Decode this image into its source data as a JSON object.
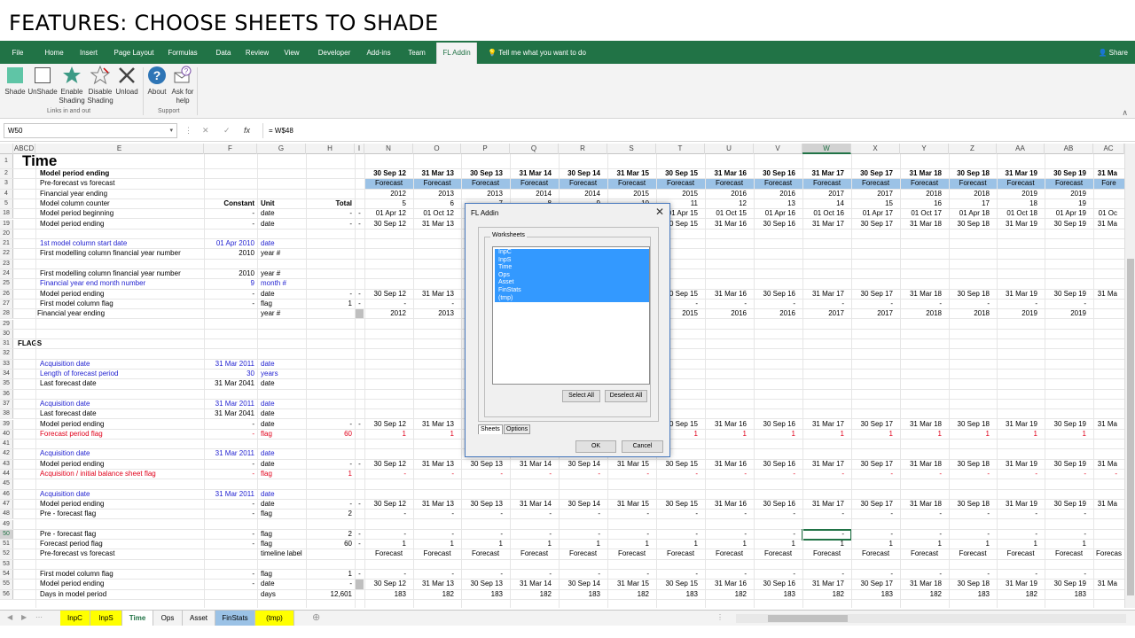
{
  "slide_title": "FEATURES: CHOOSE SHEETS TO SHADE",
  "ribbon_tabs": [
    "File",
    "Home",
    "Insert",
    "Page Layout",
    "Formulas",
    "Data",
    "Review",
    "View",
    "Developer",
    "Add-ins",
    "Team",
    "FL Addin"
  ],
  "active_ribbon_tab": "FL Addin",
  "tell_me": "Tell me what you want to do",
  "share": "Share",
  "ribbon_buttons": [
    {
      "label1": "Shade",
      "label2": "",
      "icon": "shade-square-icon"
    },
    {
      "label1": "UnShade",
      "label2": "",
      "icon": "empty-square-icon"
    },
    {
      "label1": "Enable",
      "label2": "Shading",
      "icon": "star-icon"
    },
    {
      "label1": "Disable",
      "label2": "Shading",
      "icon": "star-outline-icon"
    },
    {
      "label1": "Unload",
      "label2": "",
      "icon": "close-x-icon"
    },
    {
      "label1": "About",
      "label2": "",
      "icon": "help-icon"
    },
    {
      "label1": "Ask for",
      "label2": "help",
      "icon": "email-help-icon"
    }
  ],
  "ribbon_groups": [
    "Links in and out",
    "Support"
  ],
  "name_box": "W50",
  "formula_text": "= W$48",
  "fx_label": "fx",
  "col_headers": [
    "ABCD",
    "E",
    "F",
    "G",
    "H",
    "I",
    "N",
    "O",
    "P",
    "Q",
    "R",
    "S",
    "T",
    "U",
    "V",
    "W",
    "X",
    "Y",
    "Z",
    "AA",
    "AB",
    "AC"
  ],
  "timeline_columns": [
    "N",
    "O",
    "P",
    "Q",
    "R",
    "S",
    "T",
    "U",
    "V",
    "W",
    "X",
    "Y",
    "Z",
    "AA",
    "AB",
    "AC"
  ],
  "rows": [
    {
      "n": "1",
      "title": "Time"
    },
    {
      "n": "2",
      "e": "Model period ending",
      "bold": true,
      "t": [
        "30 Sep 12",
        "31 Mar 13",
        "30 Sep 13",
        "31 Mar 14",
        "30 Sep 14",
        "31 Mar 15",
        "30 Sep 15",
        "31 Mar 16",
        "30 Sep 16",
        "31 Mar 17",
        "30 Sep 17",
        "31 Mar 18",
        "30 Sep 18",
        "31 Mar 19",
        "30 Sep 19",
        "31 Ma"
      ]
    },
    {
      "n": "3",
      "e": "Pre-forecast vs forecast",
      "fc": true,
      "t": [
        "Forecast",
        "Forecast",
        "Forecast",
        "Forecast",
        "Forecast",
        "Forecast",
        "Forecast",
        "Forecast",
        "Forecast",
        "Forecast",
        "Forecast",
        "Forecast",
        "Forecast",
        "Forecast",
        "Forecast",
        "Fore"
      ]
    },
    {
      "n": "4",
      "e": "Financial year ending",
      "t": [
        "2012",
        "2013",
        "2013",
        "2014",
        "2014",
        "2015",
        "2015",
        "2016",
        "2016",
        "2017",
        "2017",
        "2018",
        "2018",
        "2019",
        "2019",
        ""
      ]
    },
    {
      "n": "5",
      "e": "Model column counter",
      "f": "Constant",
      "g": "Unit",
      "h": "Total",
      "t": [
        "5",
        "6",
        "7",
        "8",
        "9",
        "10",
        "11",
        "12",
        "13",
        "14",
        "15",
        "16",
        "17",
        "18",
        "19",
        ""
      ]
    },
    {
      "n": "18",
      "e": "Model period beginning",
      "f": "-",
      "g": "date",
      "h": "-",
      "i": "-",
      "t": [
        "01 Apr 12",
        "01 Oct 12",
        "01 Apr 13",
        "01 Oct 13",
        "01 Apr 14",
        "01 Oct 14",
        "01 Apr 15",
        "01 Oct 15",
        "01 Apr 16",
        "01 Oct 16",
        "01 Apr 17",
        "01 Oct 17",
        "01 Apr 18",
        "01 Oct 18",
        "01 Apr 19",
        "01 Oc"
      ]
    },
    {
      "n": "19",
      "e": "Model period ending",
      "f": "-",
      "g": "date",
      "h": "-",
      "i": "-",
      "t": [
        "30 Sep 12",
        "31 Mar 13",
        "30 Sep 13",
        "31 Mar 14",
        "30 Sep 14",
        "31 Mar 15",
        "30 Sep 15",
        "31 Mar 16",
        "30 Sep 16",
        "31 Mar 17",
        "30 Sep 17",
        "31 Mar 18",
        "30 Sep 18",
        "31 Mar 19",
        "30 Sep 19",
        "31 Ma"
      ]
    },
    {
      "n": "20"
    },
    {
      "n": "21",
      "e": "1st model column start date",
      "f": "01 Apr 2010",
      "g": "date",
      "blue": true
    },
    {
      "n": "22",
      "e": "First modelling column financial year number",
      "f": "2010",
      "g": "year #"
    },
    {
      "n": "23"
    },
    {
      "n": "24",
      "e": "First modelling column financial year number",
      "f": "2010",
      "g": "year #"
    },
    {
      "n": "25",
      "e": "Financial year end month number",
      "f": "9",
      "g": "month #",
      "blue": true
    },
    {
      "n": "26",
      "e": "Model period ending",
      "f": "-",
      "g": "date",
      "h": "-",
      "i": "-",
      "t": [
        "30 Sep 12",
        "31 Mar 13",
        "30 Sep 13",
        "31 Mar 14",
        "30 Sep 14",
        "31 Mar 15",
        "30 Sep 15",
        "31 Mar 16",
        "30 Sep 16",
        "31 Mar 17",
        "30 Sep 17",
        "31 Mar 18",
        "30 Sep 18",
        "31 Mar 19",
        "30 Sep 19",
        "31 Ma"
      ]
    },
    {
      "n": "27",
      "e": "First model column flag",
      "f": "-",
      "g": "flag",
      "h": "1",
      "i": "-",
      "t": [
        "-",
        "-",
        "-",
        "-",
        "-",
        "-",
        "-",
        "-",
        "-",
        "-",
        "-",
        "-",
        "-",
        "-",
        "-",
        ""
      ]
    },
    {
      "n": "28",
      "e": "Financial year ending",
      "g": "year #",
      "grey_i": true,
      "t": [
        "2012",
        "2013",
        "2013",
        "2014",
        "2014",
        "2015",
        "2015",
        "2016",
        "2016",
        "2017",
        "2017",
        "2018",
        "2018",
        "2019",
        "2019",
        ""
      ],
      "indent": true
    },
    {
      "n": "29"
    },
    {
      "n": "30"
    },
    {
      "n": "31",
      "d": "FLAGS",
      "bold": true
    },
    {
      "n": "32"
    },
    {
      "n": "33",
      "e": "Acquisition date",
      "f": "31 Mar 2011",
      "g": "date",
      "blue": true
    },
    {
      "n": "34",
      "e": "Length of forecast period",
      "f": "30",
      "g": "years",
      "blue": true
    },
    {
      "n": "35",
      "e": "Last forecast date",
      "f": "31 Mar 2041",
      "g": "date"
    },
    {
      "n": "36"
    },
    {
      "n": "37",
      "e": "Acquisition date",
      "f": "31 Mar 2011",
      "g": "date",
      "blue": true
    },
    {
      "n": "38",
      "e": "Last forecast date",
      "f": "31 Mar 2041",
      "g": "date"
    },
    {
      "n": "39",
      "e": "Model period ending",
      "f": "-",
      "g": "date",
      "h": "-",
      "i": "-",
      "t": [
        "30 Sep 12",
        "31 Mar 13",
        "30 Sep 13",
        "31 Mar 14",
        "30 Sep 14",
        "31 Mar 15",
        "30 Sep 15",
        "31 Mar 16",
        "30 Sep 16",
        "31 Mar 17",
        "30 Sep 17",
        "31 Mar 18",
        "30 Sep 18",
        "31 Mar 19",
        "30 Sep 19",
        "31 Ma"
      ]
    },
    {
      "n": "40",
      "e": "Forecast period flag",
      "f": "-",
      "g": "flag",
      "h": "60",
      "red": true,
      "t": [
        "1",
        "1",
        "1",
        "1",
        "1",
        "1",
        "1",
        "1",
        "1",
        "1",
        "1",
        "1",
        "1",
        "1",
        "1",
        ""
      ]
    },
    {
      "n": "41"
    },
    {
      "n": "42",
      "e": "Acquisition date",
      "f": "31 Mar 2011",
      "g": "date",
      "blue": true
    },
    {
      "n": "43",
      "e": "Model period ending",
      "f": "-",
      "g": "date",
      "h": "-",
      "i": "-",
      "t": [
        "30 Sep 12",
        "31 Mar 13",
        "30 Sep 13",
        "31 Mar 14",
        "30 Sep 14",
        "31 Mar 15",
        "30 Sep 15",
        "31 Mar 16",
        "30 Sep 16",
        "31 Mar 17",
        "30 Sep 17",
        "31 Mar 18",
        "30 Sep 18",
        "31 Mar 19",
        "30 Sep 19",
        "31 Ma"
      ]
    },
    {
      "n": "44",
      "e": "Acquisition / initial balance sheet flag",
      "f": "-",
      "g": "flag",
      "h": "1",
      "red": true,
      "t": [
        "-",
        "-",
        "-",
        "-",
        "-",
        "-",
        "-",
        "-",
        "-",
        "-",
        "-",
        "-",
        "-",
        "-",
        "-",
        "-"
      ]
    },
    {
      "n": "45"
    },
    {
      "n": "46",
      "e": "Acquisition date",
      "f": "31 Mar 2011",
      "g": "date",
      "blue": true
    },
    {
      "n": "47",
      "e": "Model period ending",
      "f": "-",
      "g": "date",
      "h": "-",
      "i": "-",
      "t": [
        "30 Sep 12",
        "31 Mar 13",
        "30 Sep 13",
        "31 Mar 14",
        "30 Sep 14",
        "31 Mar 15",
        "30 Sep 15",
        "31 Mar 16",
        "30 Sep 16",
        "31 Mar 17",
        "30 Sep 17",
        "31 Mar 18",
        "30 Sep 18",
        "31 Mar 19",
        "30 Sep 19",
        "31 Ma"
      ]
    },
    {
      "n": "48",
      "e": "Pre - forecast flag",
      "f": "-",
      "g": "flag",
      "h": "2",
      "t": [
        "-",
        "-",
        "-",
        "-",
        "-",
        "-",
        "-",
        "-",
        "-",
        "-",
        "-",
        "-",
        "-",
        "-",
        "-",
        ""
      ]
    },
    {
      "n": "49"
    },
    {
      "n": "50",
      "e": "Pre - forecast flag",
      "f": "-",
      "g": "flag",
      "h": "2",
      "i": "-",
      "sel": true,
      "t": [
        "-",
        "-",
        "-",
        "-",
        "-",
        "-",
        "-",
        "-",
        "-",
        "-",
        "-",
        "-",
        "-",
        "-",
        "-",
        ""
      ]
    },
    {
      "n": "51",
      "e": "Forecast period flag",
      "f": "-",
      "g": "flag",
      "h": "60",
      "i": "-",
      "t": [
        "1",
        "1",
        "1",
        "1",
        "1",
        "1",
        "1",
        "1",
        "1",
        "1",
        "1",
        "1",
        "1",
        "1",
        "1",
        ""
      ]
    },
    {
      "n": "52",
      "e": "Pre-forecast vs forecast",
      "g": "timeline label",
      "t": [
        "Forecast",
        "Forecast",
        "Forecast",
        "Forecast",
        "Forecast",
        "Forecast",
        "Forecast",
        "Forecast",
        "Forecast",
        "Forecast",
        "Forecast",
        "Forecast",
        "Forecast",
        "Forecast",
        "Forecast",
        "Forecas"
      ],
      "ctr": true
    },
    {
      "n": "53"
    },
    {
      "n": "54",
      "e": "First model column flag",
      "f": "-",
      "g": "flag",
      "h": "1",
      "i": "-",
      "t": [
        "-",
        "-",
        "-",
        "-",
        "-",
        "-",
        "-",
        "-",
        "-",
        "-",
        "-",
        "-",
        "-",
        "-",
        "-",
        ""
      ]
    },
    {
      "n": "55",
      "e": "Model period ending",
      "f": "-",
      "g": "date",
      "h": "-",
      "grey_i": true,
      "t": [
        "30 Sep 12",
        "31 Mar 13",
        "30 Sep 13",
        "31 Mar 14",
        "30 Sep 14",
        "31 Mar 15",
        "30 Sep 15",
        "31 Mar 16",
        "30 Sep 16",
        "31 Mar 17",
        "30 Sep 17",
        "31 Mar 18",
        "30 Sep 18",
        "31 Mar 19",
        "30 Sep 19",
        "31 Ma"
      ]
    },
    {
      "n": "56",
      "e": "Days in model period",
      "g": "days",
      "h": "12,601",
      "t": [
        "183",
        "182",
        "183",
        "182",
        "183",
        "182",
        "183",
        "182",
        "183",
        "182",
        "183",
        "182",
        "183",
        "182",
        "183",
        ""
      ]
    }
  ],
  "sheet_tabs": [
    {
      "label": "InpC",
      "style": "yellow"
    },
    {
      "label": "InpS",
      "style": "yellow"
    },
    {
      "label": "Time",
      "style": "active"
    },
    {
      "label": "Ops",
      "style": "plain"
    },
    {
      "label": "Asset",
      "style": "plain"
    },
    {
      "label": "FinStats",
      "style": "blue"
    },
    {
      "label": "(tmp)",
      "style": "yellow"
    }
  ],
  "dialog": {
    "title": "FL Addin",
    "group_label": "Worksheets",
    "worksheets": [
      "InpC",
      "InpS",
      "Time",
      "Ops",
      "Asset",
      "FinStats",
      "(tmp)"
    ],
    "select_all": "Select All",
    "deselect_all": "Deselect All",
    "tabs": [
      "Sheets",
      "Options"
    ],
    "ok": "OK",
    "cancel": "Cancel"
  },
  "colors": {
    "excel_green": "#217346",
    "forecast_fill": "#9bc2e6",
    "selection_blue": "#3399ff"
  }
}
